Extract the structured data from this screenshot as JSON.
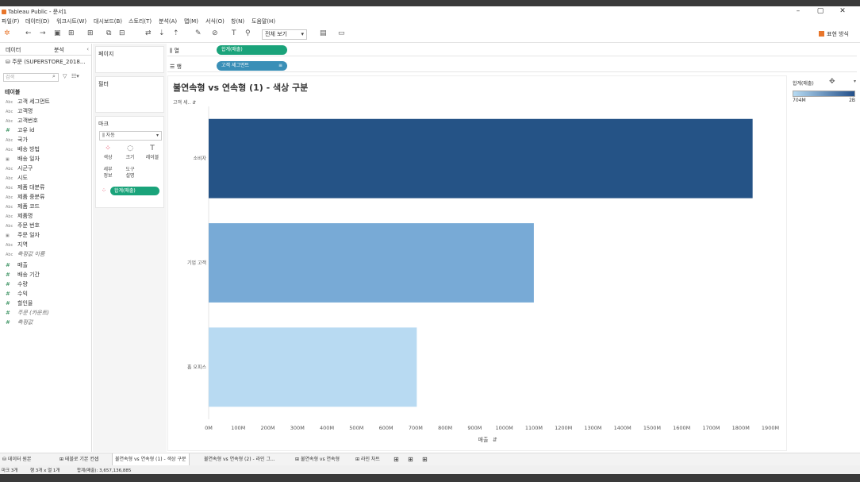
{
  "window": {
    "title": "Tableau Public - 문서1",
    "controls": [
      "–",
      "▢",
      "✕"
    ]
  },
  "menu": [
    "파일(F)",
    "데이터(D)",
    "워크시트(W)",
    "대시보드(B)",
    "스토리(T)",
    "분석(A)",
    "맵(M)",
    "서식(O)",
    "창(N)",
    "도움말(H)"
  ],
  "toolbar": {
    "view_select": "전체 보기",
    "show_me": "표현 방식"
  },
  "data_pane": {
    "tabs": [
      "데이터",
      "분석"
    ],
    "source": "주문 (SUPERSTORE_2018...",
    "search_placeholder": "검색",
    "table_header": "테이블",
    "dimensions": [
      {
        "type": "Abc",
        "name": "고객 세그먼트"
      },
      {
        "type": "Abc",
        "name": "고객명"
      },
      {
        "type": "Abc",
        "name": "고객번호"
      },
      {
        "type": "#",
        "name": "고유 id"
      },
      {
        "type": "Abc",
        "name": "국가"
      },
      {
        "type": "Abc",
        "name": "배송 방법"
      },
      {
        "type": "▣",
        "name": "배송 일자"
      },
      {
        "type": "Abc",
        "name": "시군구"
      },
      {
        "type": "Abc",
        "name": "시도"
      },
      {
        "type": "Abc",
        "name": "제품 대분류"
      },
      {
        "type": "Abc",
        "name": "제품 중분류"
      },
      {
        "type": "Abc",
        "name": "제품 코드"
      },
      {
        "type": "Abc",
        "name": "제품명"
      },
      {
        "type": "Abc",
        "name": "주문 번호"
      },
      {
        "type": "▣",
        "name": "주문 일자"
      },
      {
        "type": "Abc",
        "name": "지역"
      },
      {
        "type": "Abc",
        "name": "측정값 이름",
        "italic": true
      }
    ],
    "measures": [
      {
        "type": "#",
        "name": "매출"
      },
      {
        "type": "#",
        "name": "배송 기간"
      },
      {
        "type": "#",
        "name": "수량"
      },
      {
        "type": "#",
        "name": "수익"
      },
      {
        "type": "#",
        "name": "할인율"
      },
      {
        "type": "#",
        "name": "주문 (카운트)",
        "italic": true
      },
      {
        "type": "#",
        "name": "측정값",
        "italic": true
      }
    ]
  },
  "cards": {
    "pages": "페이지",
    "filters": "필터",
    "marks": {
      "title": "마크",
      "type": "자동",
      "buttons": [
        {
          "icon": "⁘",
          "label": "색상"
        },
        {
          "icon": "◌",
          "label": "크기"
        },
        {
          "icon": "T",
          "label": "레이블"
        },
        {
          "icon": "",
          "label": "세부\n정보"
        },
        {
          "icon": "",
          "label": "도구\n설명"
        }
      ],
      "color_pill": "합계(매출)"
    }
  },
  "shelves": {
    "columns_label": "열",
    "columns_pill": "합계(매출)",
    "rows_label": "행",
    "rows_pill": "고객 세그먼트"
  },
  "viz": {
    "title": "불연속형 vs 연속형 (1) - 색상 구분",
    "row_header": "고객 세.."
  },
  "legend": {
    "title": "합계(매출)",
    "min_label": "704M",
    "max_label": "2B"
  },
  "colors": {
    "green_pill": "#1aa37a",
    "blue_pill": "#3a8fb7"
  },
  "chart_data": {
    "type": "bar",
    "orientation": "horizontal",
    "categories": [
      "소비자",
      "기업 고객",
      "홈 오피스"
    ],
    "values": [
      1840,
      1100,
      704
    ],
    "value_unit": "M",
    "bar_colors": [
      "#255386",
      "#78aad6",
      "#b8daf2"
    ],
    "xlabel": "매출",
    "x_ticks": [
      "0M",
      "100M",
      "200M",
      "300M",
      "400M",
      "500M",
      "600M",
      "700M",
      "800M",
      "900M",
      "1000M",
      "1100M",
      "1200M",
      "1300M",
      "1400M",
      "1500M",
      "1600M",
      "1700M",
      "1800M",
      "1900M"
    ],
    "xlim": [
      0,
      1900
    ]
  },
  "sheet_tabs": [
    {
      "label": "데이터 원본"
    },
    {
      "label": "테블로 기본 컨셉"
    },
    {
      "label": "불연속형 vs 연속형 (1) - 색상 구분",
      "active": true
    },
    {
      "label": "불연속형 vs 연속형 (2) - 라인 그..."
    },
    {
      "label": "불연속형 vs 연속형"
    },
    {
      "label": "라인 차트"
    }
  ],
  "status": {
    "marks": "마크 3개",
    "rows_cols": "행 3개 x 열 1개",
    "sum": "합계(매출): 3,657,136,885"
  }
}
